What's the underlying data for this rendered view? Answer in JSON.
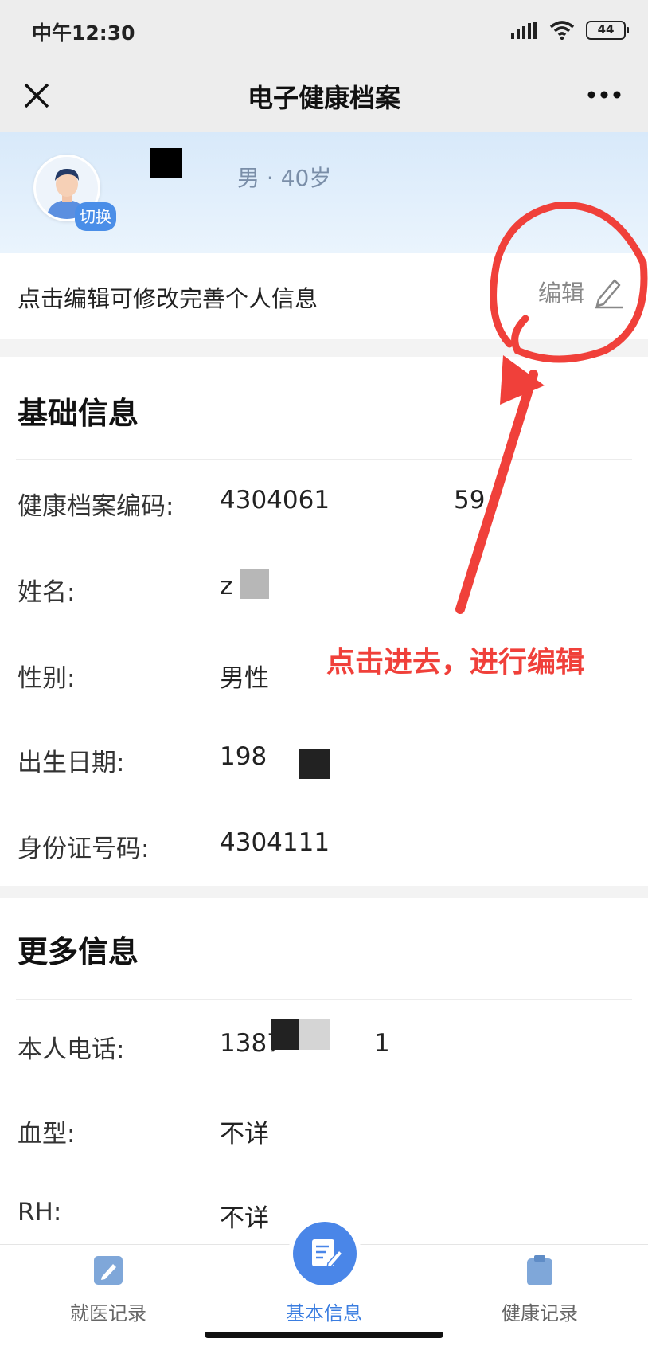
{
  "status_bar": {
    "time": "中午12:30",
    "battery": "44"
  },
  "nav": {
    "title": "电子健康档案"
  },
  "profile": {
    "switch_label": "切换",
    "gender_age": "男 · 40岁"
  },
  "edit_row": {
    "hint": "点击编辑可修改完善个人信息",
    "edit_label": "编辑"
  },
  "basic_section": {
    "title": "基础信息",
    "fields": [
      {
        "label": "健康档案编码:",
        "value": "4304061"
      },
      {
        "label": "姓名:",
        "value": "z"
      },
      {
        "label": "性别:",
        "value": "男性"
      },
      {
        "label": "出生日期:",
        "value": "198"
      },
      {
        "label": "身份证号码:",
        "value": "4304111"
      }
    ],
    "id_code_tail": "59"
  },
  "more_section": {
    "title": "更多信息",
    "fields": [
      {
        "label": "本人电话:",
        "value": "1387"
      },
      {
        "label": "血型:",
        "value": "不详"
      },
      {
        "label": "RH:",
        "value": "不详"
      }
    ],
    "phone_tail": "1"
  },
  "annotation": {
    "text": "点击进去，进行编辑",
    "color": "#f0403a"
  },
  "tabs": [
    {
      "label": "就医记录",
      "icon": "edit-note-icon",
      "active": false
    },
    {
      "label": "基本信息",
      "icon": "document-edit-icon",
      "active": true
    },
    {
      "label": "健康记录",
      "icon": "clipboard-icon",
      "active": false
    }
  ],
  "colors": {
    "accent": "#3a7de0",
    "header_bg": "#ededed",
    "profile_bg": "#d8e9fa"
  }
}
